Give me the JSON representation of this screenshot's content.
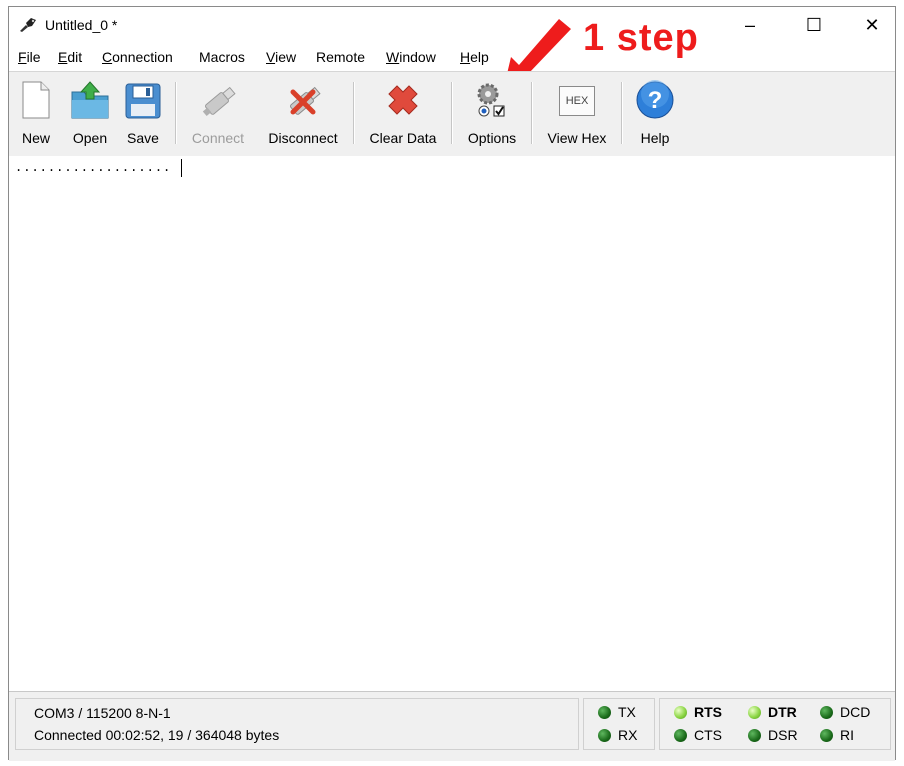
{
  "window": {
    "title": "Untitled_0 *",
    "controls": {
      "minimize": "–",
      "maximize": "☐",
      "close": "✕"
    }
  },
  "menu": {
    "items": [
      {
        "label": "File",
        "underline": "F"
      },
      {
        "label": "Edit",
        "underline": "E"
      },
      {
        "label": "Connection",
        "underline": "C"
      },
      {
        "label": "Macros",
        "underline": ""
      },
      {
        "label": "View",
        "underline": "V"
      },
      {
        "label": "Remote",
        "underline": ""
      },
      {
        "label": "Window",
        "underline": "W"
      },
      {
        "label": "Help",
        "underline": "H"
      }
    ]
  },
  "toolbar": {
    "new": "New",
    "open": "Open",
    "save": "Save",
    "connect": "Connect",
    "disconnect": "Disconnect",
    "clear_data": "Clear Data",
    "options": "Options",
    "view_hex": "View Hex",
    "help": "Help",
    "hex_icon_text": "HEX"
  },
  "annotation": {
    "text": "1 step",
    "color": "#ee1c1c"
  },
  "terminal": {
    "content": "..................."
  },
  "status": {
    "port_settings": "COM3 / 115200 8-N-1",
    "connection_info": "Connected 00:02:52, 19 / 364048 bytes",
    "signals": {
      "tx": "TX",
      "rx": "RX",
      "rts": "RTS",
      "cts": "CTS",
      "dtr": "DTR",
      "dsr": "DSR",
      "dcd": "DCD",
      "ri": "RI"
    }
  }
}
